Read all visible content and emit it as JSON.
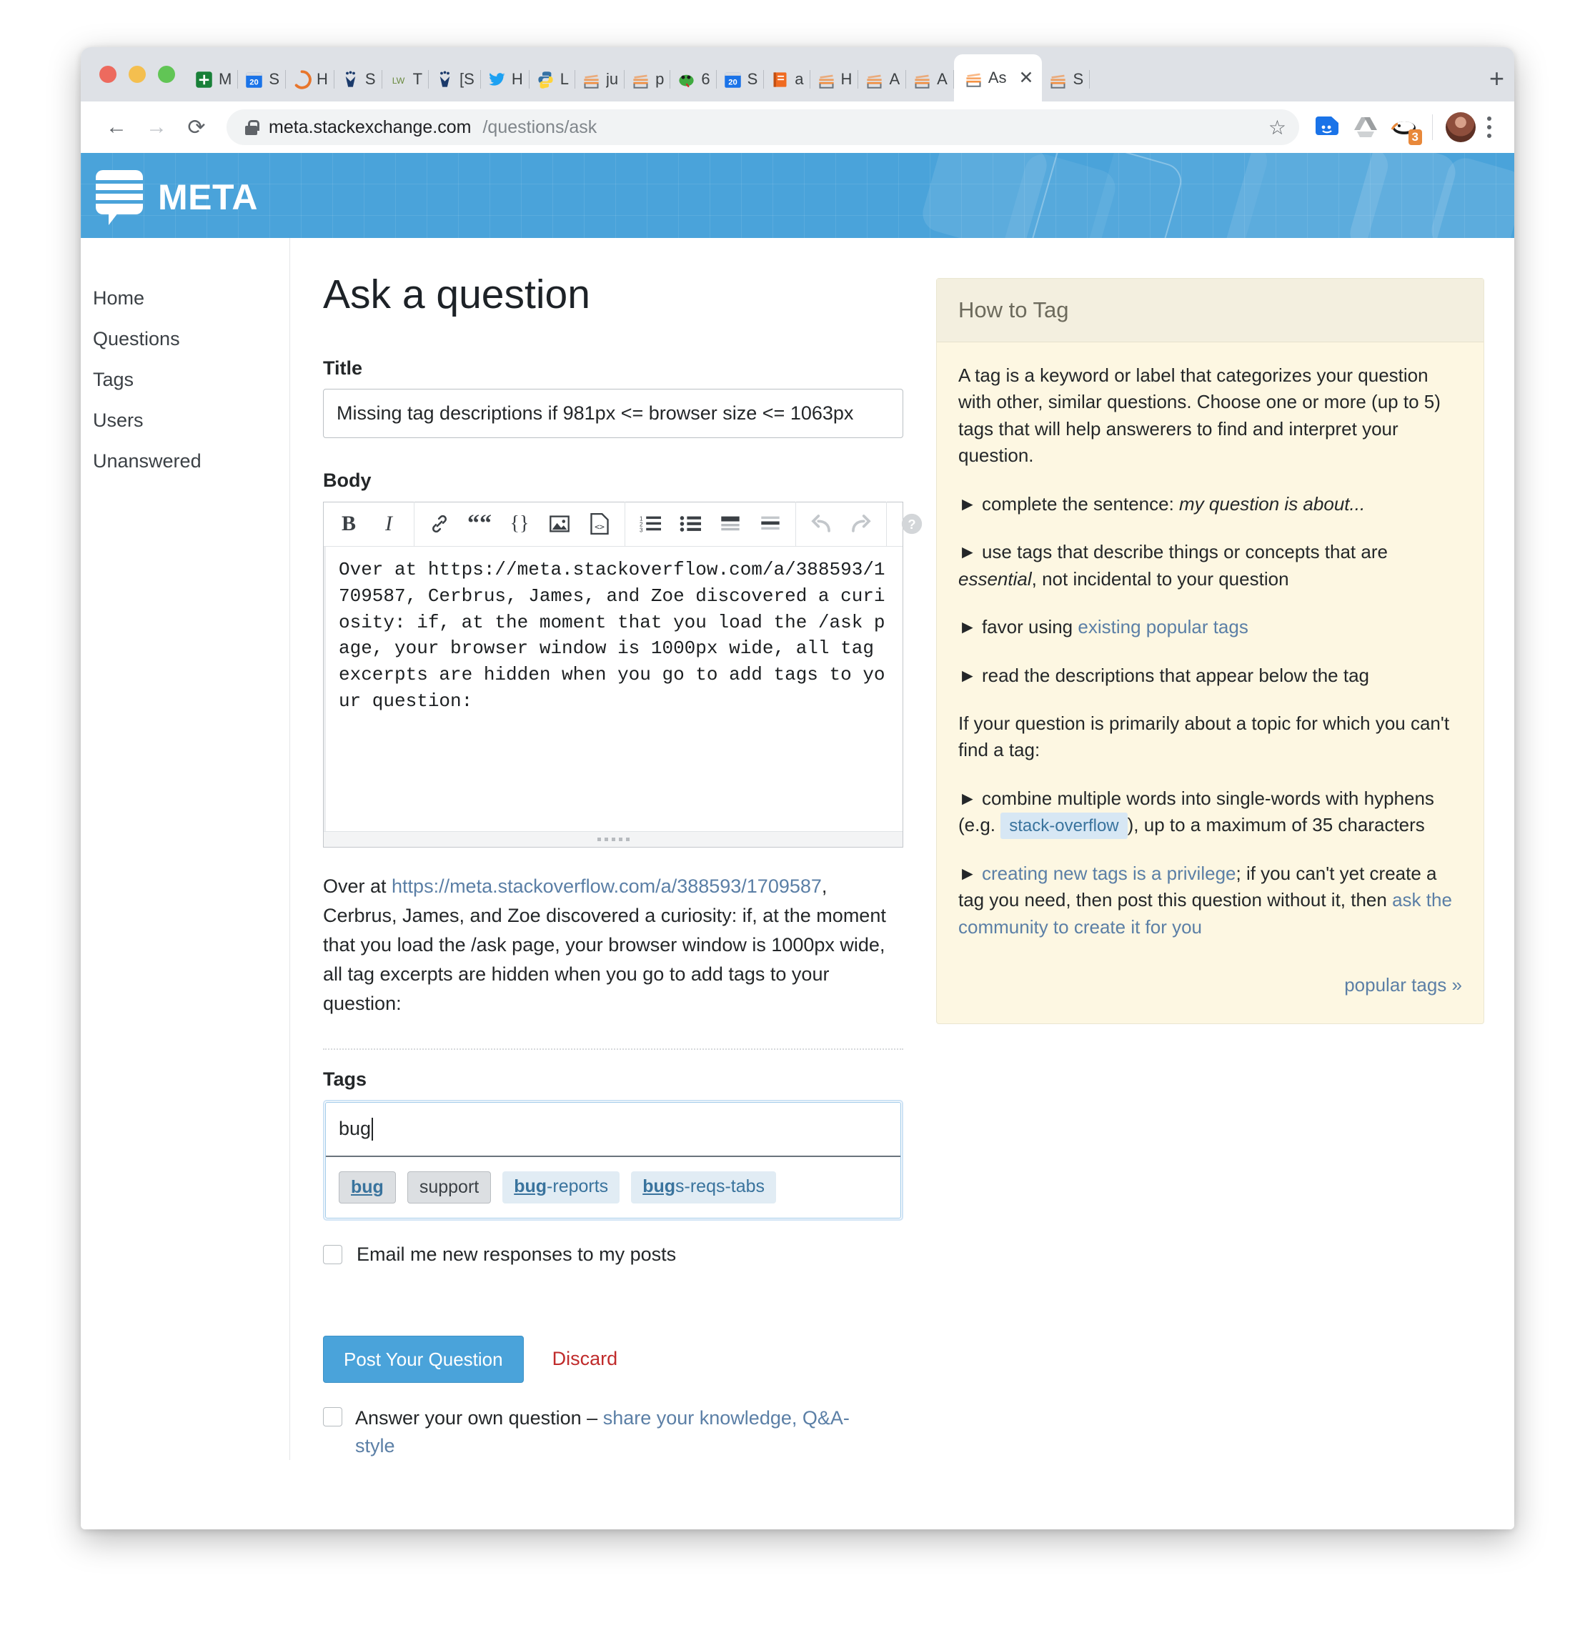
{
  "browser": {
    "tabs": [
      {
        "label": "M",
        "icon": "sheets-icon"
      },
      {
        "label": "S",
        "icon": "calendar-20-icon"
      },
      {
        "label": "H",
        "icon": "hubspot-icon"
      },
      {
        "label": "S",
        "icon": "gitlab-icon"
      },
      {
        "label": "T",
        "icon": "lw-icon"
      },
      {
        "label": "[S",
        "icon": "gitlab-icon"
      },
      {
        "label": "H",
        "icon": "twitter-icon"
      },
      {
        "label": "L",
        "icon": "python-icon"
      },
      {
        "label": "ju",
        "icon": "stackexchange-icon"
      },
      {
        "label": "p",
        "icon": "stackexchange-icon"
      },
      {
        "label": "6",
        "icon": "snake-icon"
      },
      {
        "label": "S",
        "icon": "calendar-20-icon"
      },
      {
        "label": "a",
        "icon": "book-icon"
      },
      {
        "label": "H",
        "icon": "stackexchange-icon"
      },
      {
        "label": "A",
        "icon": "stackexchange-icon"
      },
      {
        "label": "A",
        "icon": "stackexchange-icon"
      },
      {
        "label": "As",
        "icon": "stackexchange-icon",
        "active": true,
        "close": "✕"
      },
      {
        "label": "S",
        "icon": "stackexchange-icon"
      }
    ],
    "new_tab_label": "+",
    "back_label": "←",
    "forward_label": "→",
    "reload_label": "⟳",
    "url_host": "meta.stackexchange.com",
    "url_path": "/questions/ask",
    "star_label": "☆",
    "extension_badge": "3",
    "menu_label": "kebab-menu"
  },
  "site": {
    "logo_text": "META"
  },
  "sidebar": {
    "items": [
      {
        "label": "Home"
      },
      {
        "label": "Questions"
      },
      {
        "label": "Tags"
      },
      {
        "label": "Users"
      },
      {
        "label": "Unanswered"
      }
    ]
  },
  "form": {
    "page_title": "Ask a question",
    "title_label": "Title",
    "title_value": "Missing tag descriptions if 981px <= browser size <= 1063px",
    "body_label": "Body",
    "body_value": "Over at https://meta.stackoverflow.com/a/388593/1709587, Cerbrus, James, and Zoe discovered a curiosity: if, at the moment that you load the /ask page, your browser window is 1000px wide, all tag excerpts are hidden when you go to add tags to your question:",
    "toolbar": {
      "bold": "B",
      "italic": "I",
      "link": "link-icon",
      "quote": "“",
      "code": "{}",
      "image": "image-icon",
      "codeblock": "code-block-icon",
      "numbered_list": "numbered-list-icon",
      "bulleted_list": "bulleted-list-icon",
      "heading": "heading-icon",
      "rule": "horizontal-rule-icon",
      "undo": "undo-icon",
      "redo": "redo-icon",
      "help": "?"
    },
    "preview": {
      "before_link": "Over at ",
      "link_text": "https://meta.stackoverflow.com/a/388593/1709587",
      "after_link": ", Cerbrus, James, and Zoe discovered a curiosity: if, at the moment that you load the /ask page, your browser window is 1000px wide, all tag excerpts are hidden when you go to add tags to your question:"
    },
    "tags_label": "Tags",
    "tags_value": "bug",
    "tag_suggestions": [
      {
        "match": "bug",
        "rest": "",
        "style": "selected"
      },
      {
        "match": "",
        "rest": "support",
        "style": "plain-selected"
      },
      {
        "match": "bug",
        "rest": "-reports",
        "style": "normal"
      },
      {
        "match": "bug",
        "rest": "s-reqs-tabs",
        "style": "normal"
      }
    ],
    "email_checkbox_label": "Email me new responses to my posts",
    "post_button": "Post Your Question",
    "discard_button": "Discard",
    "answer_own_label": "Answer your own question – ",
    "answer_own_link": "share your knowledge, Q&A-style"
  },
  "how_to_tag": {
    "title": "How to Tag",
    "intro": "A tag is a keyword or label that categorizes your question with other, similar questions. Choose one or more (up to 5) tags that will help answerers to find and interpret your question.",
    "bullet1_pre": "► complete the sentence: ",
    "bullet1_em": "my question is about...",
    "bullet2_pre": "► use tags that describe things or concepts that are ",
    "bullet2_em": "essential",
    "bullet2_post": ", not incidental to your question",
    "bullet3_pre": "► favor using ",
    "bullet3_link": "existing popular tags",
    "bullet4": "► read the descriptions that appear below the tag",
    "para2": "If your question is primarily about a topic for which you can't find a tag:",
    "bullet5_pre": "► combine multiple words into single-words with hyphens (e.g. ",
    "bullet5_tag": "stack-overflow",
    "bullet5_post": "), up to a maximum of 35 characters",
    "bullet6_pre": "► ",
    "bullet6_link": "creating new tags is a privilege",
    "bullet6_mid": "; if you can't yet create a tag you need, then post this question without it, then ",
    "bullet6_link2": "ask the community to create it for you",
    "popular_tags": "popular tags »"
  },
  "colors": {
    "brand": "#4aa3da",
    "link": "#5b7fa6",
    "discard": "#c02b2b",
    "panel_bg": "#fdf7e2"
  }
}
